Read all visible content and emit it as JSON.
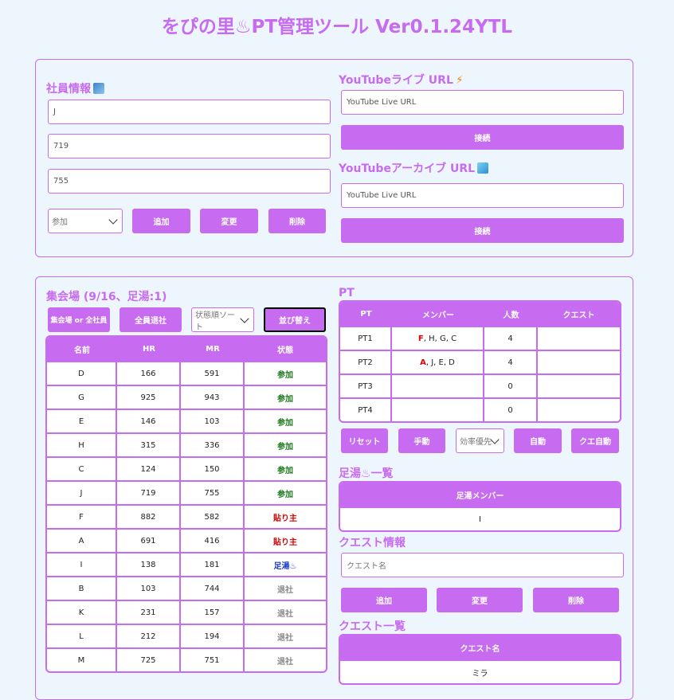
{
  "app": {
    "title": "をぴの里♨PT管理ツール Ver0.1.24YTL"
  },
  "employee": {
    "heading": "社員情報",
    "name_value": "J",
    "hr_value": "719",
    "mr_value": "755",
    "status_selected": "参加",
    "add_label": "追加",
    "change_label": "変更",
    "delete_label": "削除"
  },
  "youtube_live": {
    "heading": "YouTubeライブ URL",
    "placeholder": "YouTube Live URL",
    "connect_label": "接続"
  },
  "youtube_archive": {
    "heading": "YouTubeアーカイブ URL",
    "placeholder": "YouTube Live URL",
    "connect_label": "接続"
  },
  "gathering": {
    "heading": "集会場 (9/16、足湯:1)",
    "toggle_label": "集会場 or 全社員",
    "leave_all_label": "全員退社",
    "sort_selected": "状態順ソート",
    "sort_label": "並び替え",
    "columns": [
      "名前",
      "HR",
      "MR",
      "状態"
    ],
    "rows": [
      {
        "name": "D",
        "hr": "166",
        "mr": "591",
        "status": "参加",
        "kind": "join"
      },
      {
        "name": "G",
        "hr": "925",
        "mr": "943",
        "status": "参加",
        "kind": "join"
      },
      {
        "name": "E",
        "hr": "146",
        "mr": "103",
        "status": "参加",
        "kind": "join"
      },
      {
        "name": "H",
        "hr": "315",
        "mr": "336",
        "status": "参加",
        "kind": "join"
      },
      {
        "name": "C",
        "hr": "124",
        "mr": "150",
        "status": "参加",
        "kind": "join"
      },
      {
        "name": "J",
        "hr": "719",
        "mr": "755",
        "status": "参加",
        "kind": "join"
      },
      {
        "name": "F",
        "hr": "882",
        "mr": "582",
        "status": "貼り主",
        "kind": "stick"
      },
      {
        "name": "A",
        "hr": "691",
        "mr": "416",
        "status": "貼り主",
        "kind": "stick"
      },
      {
        "name": "I",
        "hr": "138",
        "mr": "181",
        "status": "足湯♨",
        "kind": "foot"
      },
      {
        "name": "B",
        "hr": "103",
        "mr": "744",
        "status": "退社",
        "kind": "leave"
      },
      {
        "name": "K",
        "hr": "231",
        "mr": "157",
        "status": "退社",
        "kind": "leave"
      },
      {
        "name": "L",
        "hr": "212",
        "mr": "194",
        "status": "退社",
        "kind": "leave"
      },
      {
        "name": "M",
        "hr": "725",
        "mr": "751",
        "status": "退社",
        "kind": "leave"
      }
    ]
  },
  "pt": {
    "heading": "PT",
    "columns": [
      "PT",
      "メンバー",
      "人数",
      "クエスト"
    ],
    "rows": [
      {
        "pt": "PT1",
        "leader": "F",
        "rest": ", H, G, C",
        "count": "4",
        "quest": ""
      },
      {
        "pt": "PT2",
        "leader": "A",
        "rest": ", J, E, D",
        "count": "4",
        "quest": ""
      },
      {
        "pt": "PT3",
        "leader": "",
        "rest": "",
        "count": "0",
        "quest": ""
      },
      {
        "pt": "PT4",
        "leader": "",
        "rest": "",
        "count": "0",
        "quest": ""
      }
    ],
    "reset_label": "リセット",
    "manual_label": "手動",
    "mode_selected": "効率優先",
    "auto_label": "自動",
    "quest_auto_label": "クエ自動"
  },
  "footbath": {
    "heading": "足湯♨一覧",
    "column": "足湯メンバー",
    "members": [
      "I"
    ]
  },
  "quest_info": {
    "heading": "クエスト情報",
    "placeholder": "クエスト名",
    "add_label": "追加",
    "change_label": "変更",
    "delete_label": "削除"
  },
  "quest_list": {
    "heading": "クエスト一覧",
    "column": "クエスト名",
    "items": [
      "ミラ"
    ]
  },
  "colors": {
    "accent": "#c76bf0",
    "background": "#eef6fd",
    "join": "#1a7a1a",
    "stick": "#d40000",
    "foot": "#1a3ad4",
    "leave": "#888888"
  }
}
